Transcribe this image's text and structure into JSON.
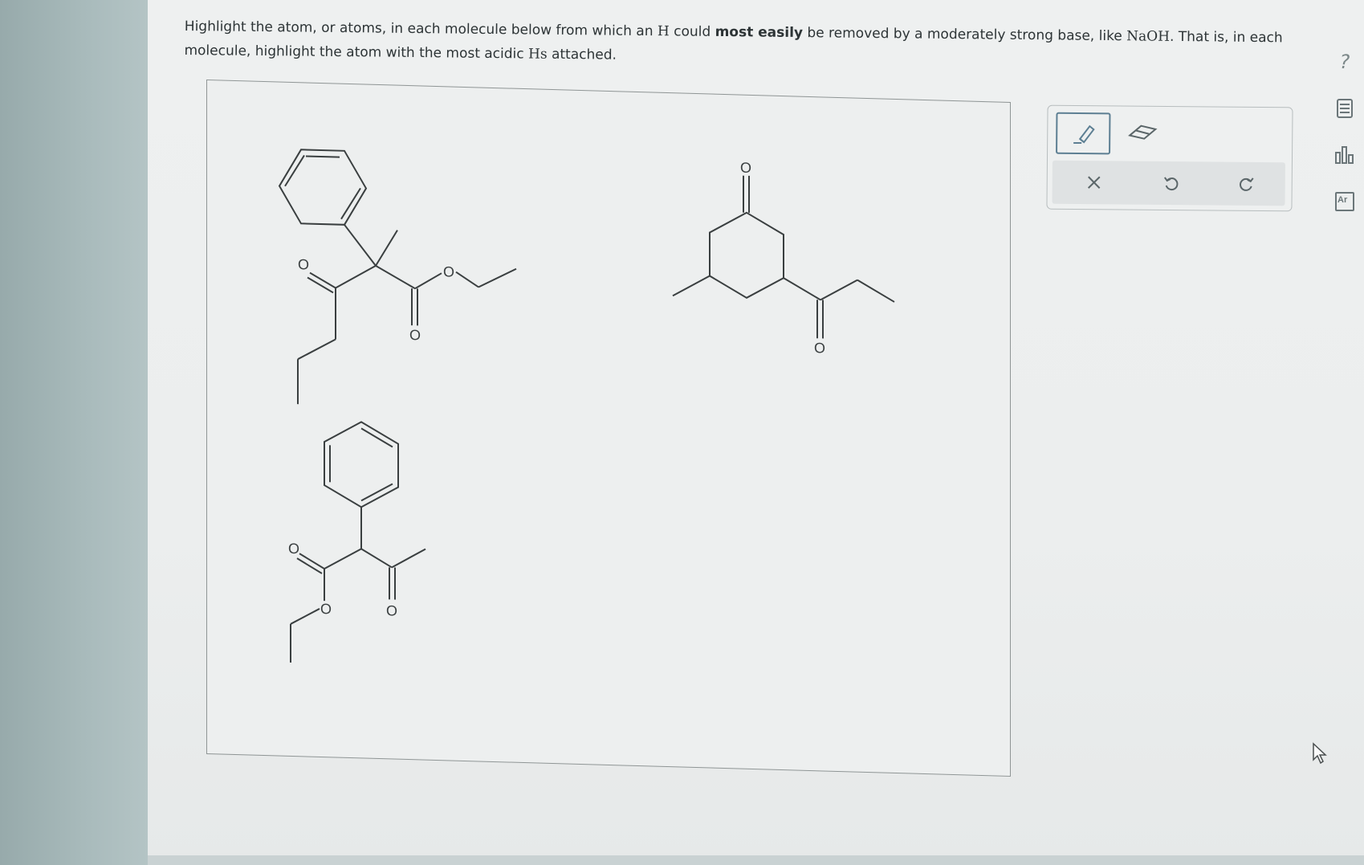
{
  "question": {
    "p1": "Highlight the atom, or atoms, in each molecule below from which an ",
    "h1": "H",
    "p2": " could ",
    "bold": "most easily",
    "p3": " be removed by a moderately strong base, like ",
    "naoh": "NaOH",
    "p4": ". That is, in each molecule, highlight the atom with the most acidic ",
    "hs": "Hs",
    "p5": " attached."
  },
  "atom_label": "O",
  "toolbar": {
    "tools": [
      "pencil-icon",
      "eraser-icon"
    ],
    "actions": [
      "close-icon",
      "undo-icon",
      "redo-icon"
    ]
  },
  "side_icons": [
    "help-icon",
    "calculator-icon",
    "chart-icon",
    "periodic-table-icon"
  ],
  "help_label": "?",
  "periodic_label": "Ar"
}
